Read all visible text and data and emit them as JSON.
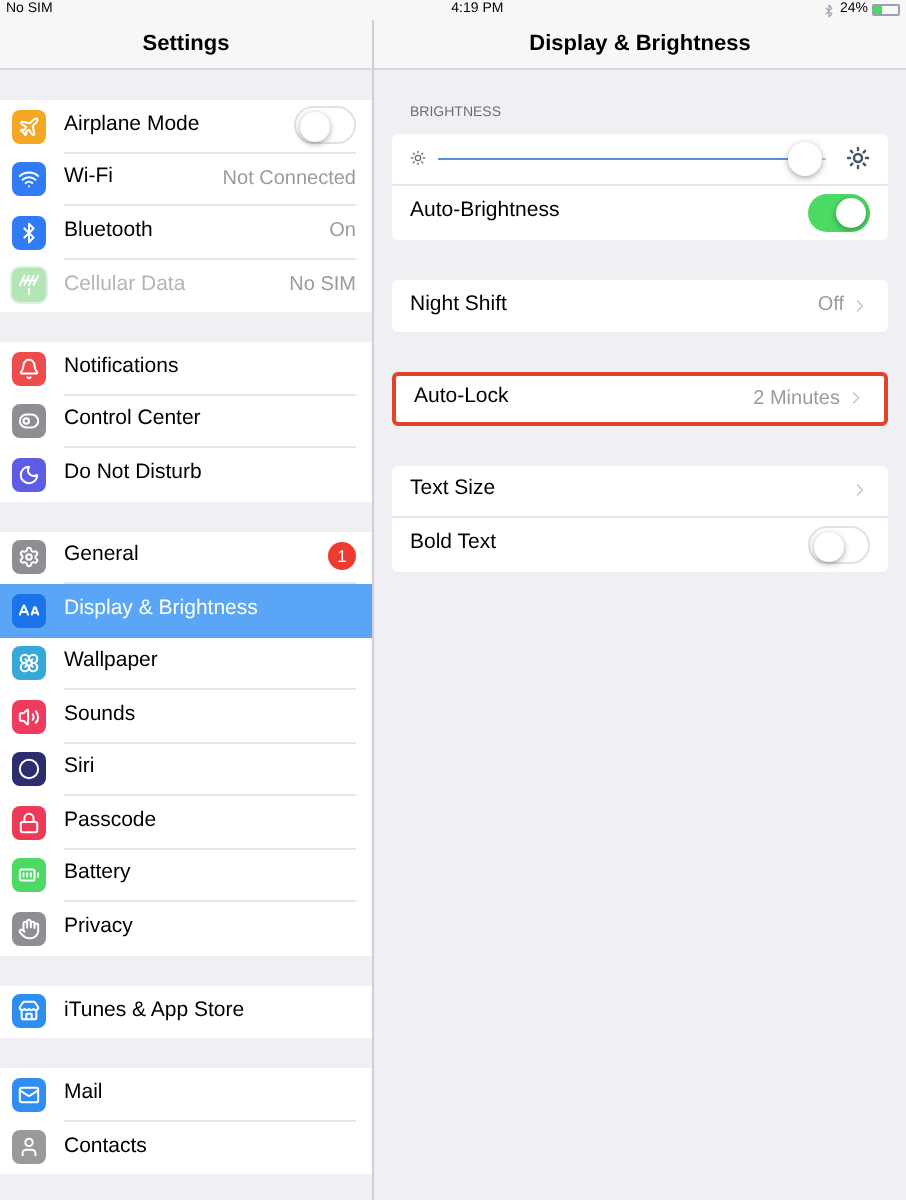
{
  "status_bar": {
    "carrier": "No SIM",
    "time": "4:19 PM",
    "battery": "24%"
  },
  "sidebar": {
    "title": "Settings",
    "groups": [
      [
        {
          "label": "Airplane Mode",
          "kind": "toggle",
          "on": false,
          "color": "#f5a623",
          "selected": false,
          "disabled": false
        },
        {
          "label": "Wi-Fi",
          "kind": "value",
          "value": "Not Connected",
          "color": "#2f7cf6",
          "selected": false,
          "disabled": false
        },
        {
          "label": "Bluetooth",
          "kind": "value",
          "value": "On",
          "color": "#2f7cf6",
          "selected": false,
          "disabled": false
        },
        {
          "label": "Cellular Data",
          "kind": "value",
          "value": "No SIM",
          "color": "#b2e6b6",
          "selected": false,
          "disabled": true
        }
      ],
      [
        {
          "label": "Notifications",
          "kind": "plain",
          "color": "#ee4b4b",
          "selected": false,
          "disabled": false
        },
        {
          "label": "Control Center",
          "kind": "plain",
          "color": "#8e8e93",
          "selected": false,
          "disabled": false
        },
        {
          "label": "Do Not Disturb",
          "kind": "plain",
          "color": "#5e5ce6",
          "selected": false,
          "disabled": false
        }
      ],
      [
        {
          "label": "General",
          "kind": "badge",
          "badge": "1",
          "color": "#8e8e93",
          "selected": false,
          "disabled": false
        },
        {
          "label": "Display & Brightness",
          "kind": "plain",
          "color": "#1a73e8",
          "selected": true,
          "disabled": false
        },
        {
          "label": "Wallpaper",
          "kind": "plain",
          "color": "#36a9d8",
          "selected": false,
          "disabled": false
        },
        {
          "label": "Sounds",
          "kind": "plain",
          "color": "#ef3b5d",
          "selected": false,
          "disabled": false
        },
        {
          "label": "Siri",
          "kind": "plain",
          "color": "#2c2c6e",
          "selected": false,
          "disabled": false
        },
        {
          "label": "Passcode",
          "kind": "plain",
          "color": "#ec3a57",
          "selected": false,
          "disabled": false
        },
        {
          "label": "Battery",
          "kind": "plain",
          "color": "#4cd964",
          "selected": false,
          "disabled": false
        },
        {
          "label": "Privacy",
          "kind": "plain",
          "color": "#8e8e93",
          "selected": false,
          "disabled": false
        }
      ],
      [
        {
          "label": "iTunes & App Store",
          "kind": "plain",
          "color": "#2d8ef0",
          "selected": false,
          "disabled": false
        }
      ],
      [
        {
          "label": "Mail",
          "kind": "plain",
          "color": "#2f8ef0",
          "selected": false,
          "disabled": false
        },
        {
          "label": "Contacts",
          "kind": "plain",
          "color": "#9a9a9a",
          "selected": false,
          "disabled": false
        }
      ]
    ]
  },
  "detail": {
    "title": "Display & Brightness",
    "section_header": "BRIGHTNESS",
    "groups": [
      [
        {
          "kind": "slider",
          "level": 0.95,
          "highlighted": false
        },
        {
          "kind": "toggle",
          "label": "Auto-Brightness",
          "on": true,
          "highlighted": false
        }
      ],
      [
        {
          "kind": "link",
          "label": "Night Shift",
          "value": "Off",
          "highlighted": false
        }
      ],
      [
        {
          "kind": "link",
          "label": "Auto-Lock",
          "value": "2 Minutes",
          "highlighted": true
        }
      ],
      [
        {
          "kind": "link",
          "label": "Text Size",
          "highlighted": false
        },
        {
          "kind": "toggle",
          "label": "Bold Text",
          "on": false,
          "highlighted": false
        }
      ]
    ]
  }
}
